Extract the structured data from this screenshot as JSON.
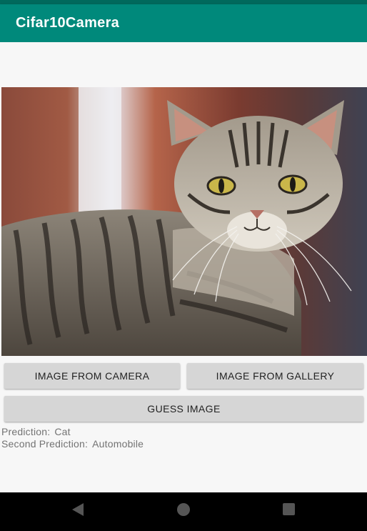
{
  "app": {
    "title": "Cifar10Camera",
    "accent_color": "#00897b",
    "status_color": "#00695c"
  },
  "image": {
    "subject": "tabby cat photo"
  },
  "buttons": {
    "camera_label": "IMAGE FROM CAMERA",
    "gallery_label": "IMAGE FROM GALLERY",
    "guess_label": "GUESS IMAGE"
  },
  "results": {
    "prediction_label": "Prediction:",
    "prediction_value": "Cat",
    "second_label": "Second Prediction:",
    "second_value": "Automobile"
  },
  "nav": {
    "icons": [
      "back-icon",
      "home-icon",
      "recents-icon"
    ]
  }
}
